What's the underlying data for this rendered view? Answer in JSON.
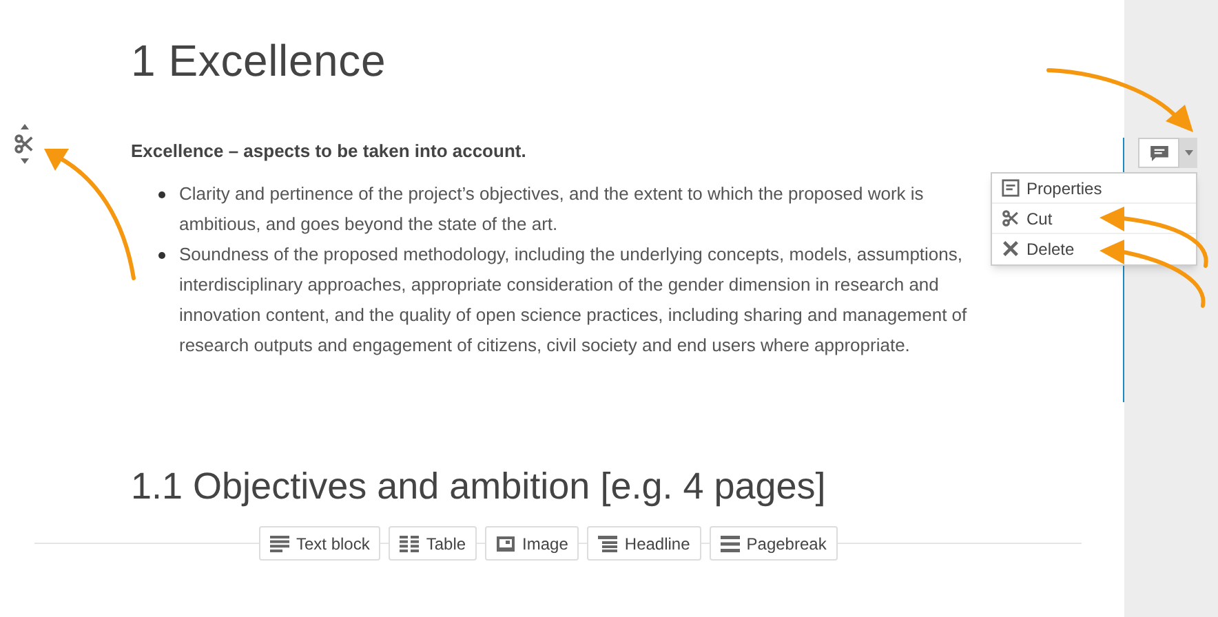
{
  "heading": "1 Excellence",
  "section": {
    "title": "Excellence – aspects to be taken into account.",
    "bullets": [
      "Clarity and pertinence of the project’s objectives, and the extent to which the proposed work is ambitious, and goes beyond the state of the art.",
      "Soundness of the proposed methodology, including the underlying concepts, models, assumptions, interdisciplinary approaches, appropriate consideration of the gender dimension in research and innovation content, and the quality of open science practices, including sharing and management of research outputs and engagement of citizens, civil society and end users where appropriate."
    ]
  },
  "menu": {
    "expanded": true,
    "items": [
      {
        "kind": "properties",
        "label": "Properties"
      },
      {
        "kind": "cut",
        "label": "Cut"
      },
      {
        "kind": "delete",
        "label": "Delete"
      }
    ]
  },
  "subheading": "1.1 Objectives and ambition [e.g. 4 pages]",
  "insert_buttons": [
    {
      "kind": "text",
      "label": "Text block"
    },
    {
      "kind": "table",
      "label": "Table"
    },
    {
      "kind": "image",
      "label": "Image"
    },
    {
      "kind": "headline",
      "label": "Headline"
    },
    {
      "kind": "pagebreak",
      "label": "Pagebreak"
    }
  ]
}
